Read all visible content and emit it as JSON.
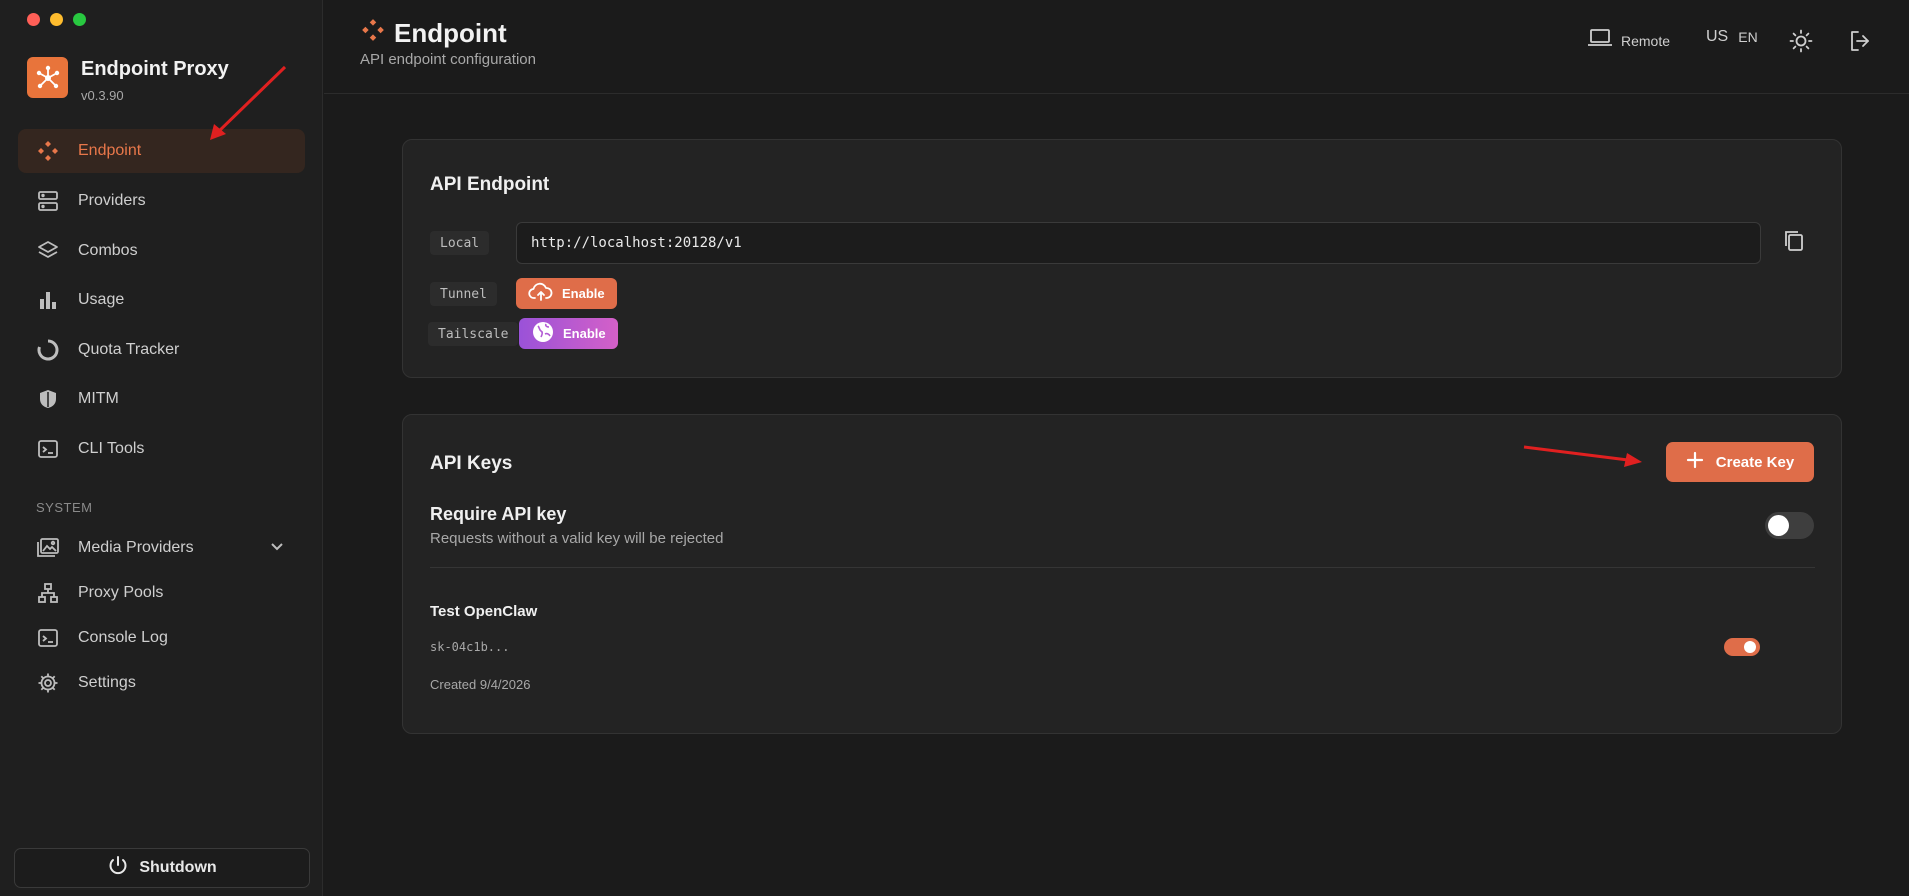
{
  "app": {
    "name": "Endpoint Proxy",
    "version": "v0.3.90"
  },
  "sidebar": {
    "items": [
      {
        "label": "Endpoint",
        "icon": "endpoint-icon",
        "active": true
      },
      {
        "label": "Providers",
        "icon": "server-icon"
      },
      {
        "label": "Combos",
        "icon": "layers-icon"
      },
      {
        "label": "Usage",
        "icon": "bar-chart-icon"
      },
      {
        "label": "Quota Tracker",
        "icon": "ring-icon"
      },
      {
        "label": "MITM",
        "icon": "shield-icon"
      },
      {
        "label": "CLI Tools",
        "icon": "terminal-icon"
      }
    ],
    "section_label": "SYSTEM",
    "system_items": [
      {
        "label": "Media Providers",
        "icon": "media-icon"
      },
      {
        "label": "Proxy Pools",
        "icon": "network-icon"
      },
      {
        "label": "Console Log",
        "icon": "terminal-icon"
      },
      {
        "label": "Settings",
        "icon": "gear-icon"
      }
    ],
    "shutdown_label": "Shutdown"
  },
  "header": {
    "title": "Endpoint",
    "subtitle": "API endpoint configuration",
    "remote_label": "Remote",
    "country": "US",
    "language": "EN"
  },
  "endpoint_card": {
    "title": "API Endpoint",
    "local_label": "Local",
    "local_url": "http://localhost:20128/v1",
    "tunnel_label": "Tunnel",
    "tunnel_button": "Enable",
    "tailscale_label": "Tailscale",
    "tailscale_button": "Enable"
  },
  "keys_card": {
    "title": "API Keys",
    "create_button": "Create Key",
    "require_title": "Require API key",
    "require_desc": "Requests without a valid key will be rejected",
    "require_enabled": false,
    "keys": [
      {
        "name": "Test OpenClaw",
        "key": "sk-04c1b...",
        "created": "Created 9/4/2026",
        "enabled": true
      }
    ]
  },
  "colors": {
    "accent": "#df6d49",
    "tailscale": "#b85ce0",
    "active_bg": "#34261f"
  }
}
